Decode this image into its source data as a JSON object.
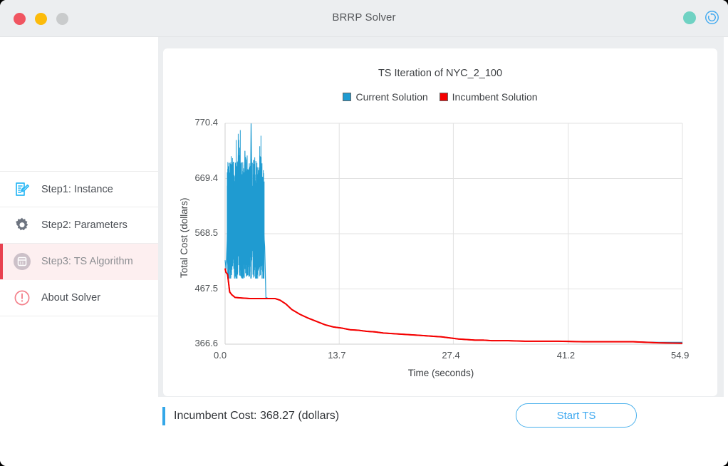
{
  "window": {
    "title": "BRRP Solver",
    "traffic_lights": [
      "close-button",
      "minimize-button",
      "maximize-button"
    ],
    "right_icons": [
      "status-dot",
      "sync-icon"
    ]
  },
  "sidebar": {
    "items": [
      {
        "label": "Step1: Instance",
        "icon": "edit-document-icon",
        "active": false
      },
      {
        "label": "Step2: Parameters",
        "icon": "gear-icon",
        "active": false
      },
      {
        "label": "Step3: TS Algorithm",
        "icon": "calendar-icon",
        "active": true
      },
      {
        "label": "About Solver",
        "icon": "exclamation-circle-icon",
        "active": false
      }
    ]
  },
  "status": {
    "incumbent_cost_text": "Incumbent Cost: 368.27 (dollars)",
    "start_button_label": "Start TS"
  },
  "colors": {
    "current_solution": "#1f9bd1",
    "incumbent_solution": "#f40000",
    "accent_blue": "#3fa9f0",
    "active_bar": "#e8414f",
    "active_bg": "#fdeff0"
  },
  "chart_data": {
    "type": "line",
    "title": "TS Iteration of NYC_2_100",
    "xlabel": "Time (seconds)",
    "ylabel": "Total Cost (dollars)",
    "xlim": [
      0.0,
      54.9
    ],
    "ylim": [
      366.6,
      770.4
    ],
    "xticks": [
      "0.0",
      "13.7",
      "27.4",
      "41.2",
      "54.9"
    ],
    "xtick_values": [
      0.0,
      13.7,
      27.4,
      41.2,
      54.9
    ],
    "yticks": [
      "366.6",
      "467.5",
      "568.5",
      "669.4",
      "770.4"
    ],
    "ytick_values": [
      366.6,
      467.5,
      568.5,
      669.4,
      770.4
    ],
    "grid": true,
    "legend": {
      "position": "top-center",
      "entries": [
        {
          "name": "Current Solution",
          "color": "#1f9bd1"
        },
        {
          "name": "Incumbent Solution",
          "color": "#f40000"
        }
      ]
    },
    "series": [
      {
        "name": "Current Solution",
        "color": "#1f9bd1",
        "note": "High-frequency oscillation between ~490 and ~770 during first ~4.5 s, then collapses and decays monotonically toward ~370",
        "x": [
          0.0,
          0.12,
          0.25,
          0.38,
          0.5,
          0.62,
          0.75,
          0.88,
          1.0,
          1.12,
          1.25,
          1.38,
          1.5,
          1.62,
          1.75,
          1.88,
          2.0,
          2.12,
          2.25,
          2.38,
          2.5,
          2.62,
          2.75,
          2.88,
          3.0,
          3.12,
          3.25,
          3.38,
          3.5,
          3.62,
          3.75,
          3.88,
          4.0,
          4.12,
          4.25,
          4.38,
          4.5,
          4.62,
          4.75,
          4.9,
          5.2,
          5.6,
          6.0,
          6.6,
          7.3,
          8.0,
          9.0,
          10.0,
          11.0,
          12.0,
          13.0,
          14.0,
          15.0,
          16.0,
          17.0,
          18.0,
          19.0,
          20.0,
          21.0,
          22.0,
          23.0,
          24.0,
          25.0,
          26.0,
          27.0,
          28.0,
          29.0,
          30.0,
          31.0,
          32.0,
          34.0,
          36.0,
          38.0,
          40.0,
          43.0,
          46.0,
          49.0,
          52.0,
          54.9
        ],
        "y": [
          520,
          503,
          556,
          669,
          598,
          545,
          620,
          512,
          700,
          560,
          588,
          498,
          645,
          740,
          572,
          530,
          612,
          668,
          545,
          720,
          580,
          515,
          640,
          600,
          558,
          770,
          605,
          530,
          690,
          555,
          612,
          580,
          660,
          520,
          640,
          668,
          598,
          575,
          545,
          452,
          450,
          450,
          450,
          447,
          440,
          430,
          421,
          414,
          408,
          402,
          398,
          396,
          393,
          392,
          390,
          389,
          387,
          386,
          385,
          384,
          383,
          382,
          381,
          380,
          378,
          376,
          375,
          374,
          374,
          373,
          373,
          372,
          372,
          372,
          371,
          371,
          371,
          370,
          370
        ]
      },
      {
        "name": "Incumbent Solution",
        "color": "#f40000",
        "note": "Monotone non-increasing step function, starts ~505 then drops to ~450 and decays to 368.27",
        "x": [
          0.0,
          0.1,
          0.3,
          0.55,
          0.8,
          1.2,
          2.0,
          3.0,
          4.0,
          4.6,
          4.8,
          5.2,
          5.6,
          6.0,
          6.6,
          7.3,
          8.0,
          9.0,
          10.0,
          11.0,
          12.0,
          13.0,
          14.0,
          15.0,
          16.0,
          17.0,
          18.0,
          19.0,
          20.0,
          21.0,
          22.0,
          23.0,
          24.0,
          25.0,
          26.0,
          27.0,
          28.0,
          29.0,
          30.0,
          31.0,
          32.0,
          34.0,
          36.0,
          38.0,
          40.0,
          43.0,
          46.0,
          49.0,
          52.0,
          54.9
        ],
        "y": [
          505,
          498,
          494,
          462,
          457,
          452,
          451,
          450,
          450,
          450,
          450,
          450,
          450,
          450,
          447,
          440,
          430,
          421,
          414,
          408,
          402,
          398,
          396,
          393,
          392,
          390,
          389,
          387,
          386,
          385,
          384,
          383,
          382,
          381,
          380,
          378,
          376,
          375,
          374,
          374,
          373,
          373,
          372,
          372,
          372,
          371,
          371,
          371,
          369,
          368.27
        ]
      }
    ]
  }
}
